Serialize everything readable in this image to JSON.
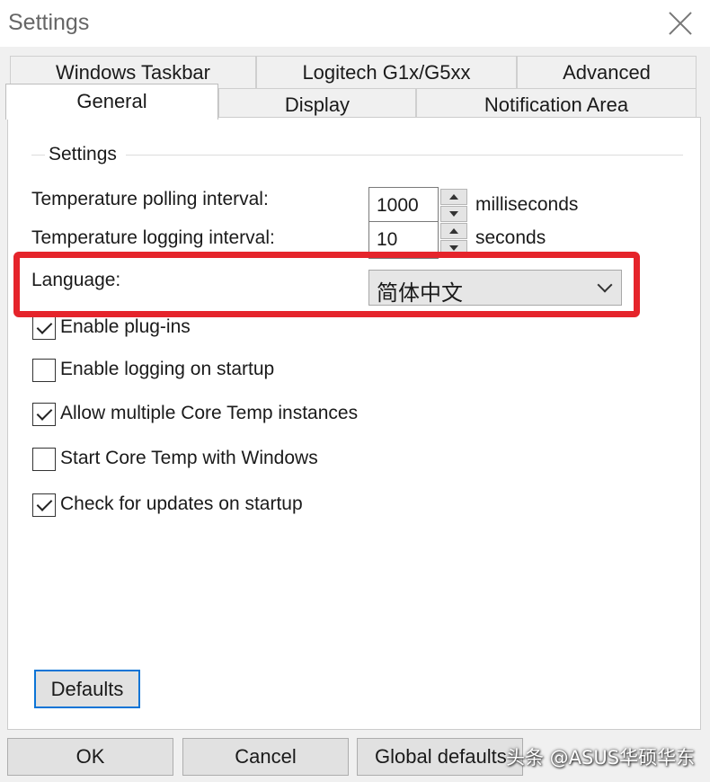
{
  "window": {
    "title": "Settings"
  },
  "tabs": {
    "row_back": [
      "Windows Taskbar",
      "Logitech G1x/G5xx",
      "Advanced"
    ],
    "row_front": [
      "General",
      "Display",
      "Notification Area"
    ],
    "active": "General"
  },
  "general": {
    "group_title": "Settings",
    "polling": {
      "label": "Temperature polling interval:",
      "value": "1000",
      "unit": "milliseconds"
    },
    "logging": {
      "label": "Temperature logging interval:",
      "value": "10",
      "unit": "seconds"
    },
    "language": {
      "label": "Language:",
      "selected": "简体中文"
    },
    "checkboxes": [
      {
        "label": "Enable plug-ins",
        "checked": true
      },
      {
        "label": "Enable logging on startup",
        "checked": false
      },
      {
        "label": "Allow multiple Core Temp instances",
        "checked": true
      },
      {
        "label": "Start Core Temp with Windows",
        "checked": false
      },
      {
        "label": "Check for updates on startup",
        "checked": true
      }
    ],
    "defaults_label": "Defaults"
  },
  "footer": {
    "ok": "OK",
    "cancel": "Cancel",
    "global_defaults": "Global defaults"
  },
  "watermark": "头条 @ASUS华硕华东",
  "colors": {
    "highlight": "#e5242b",
    "focus_border": "#0a74d6"
  }
}
